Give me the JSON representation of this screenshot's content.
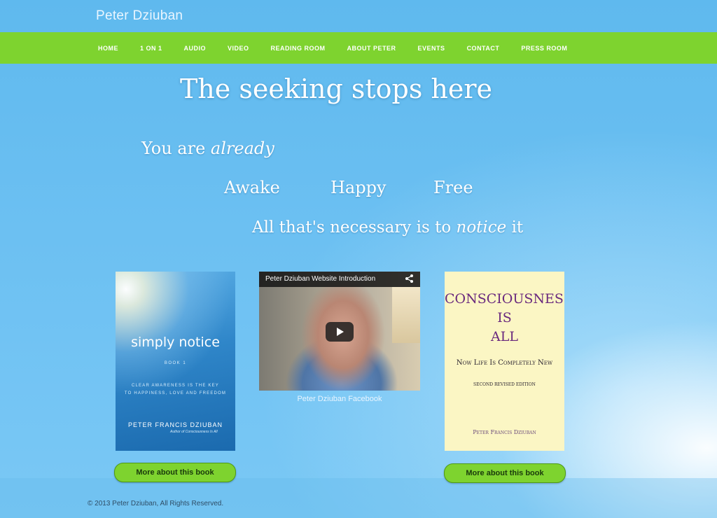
{
  "site": {
    "title": "Peter Dziuban"
  },
  "nav": {
    "items": [
      "HOME",
      "1 ON 1",
      "AUDIO",
      "VIDEO",
      "READING ROOM",
      "ABOUT PETER",
      "EVENTS",
      "CONTACT",
      "PRESS ROOM"
    ]
  },
  "hero": {
    "headline": "The seeking stops here",
    "line2_prefix": "You are ",
    "line2_em": "already",
    "words": [
      "Awake",
      "Happy",
      "Free"
    ],
    "line4_prefix": "All that's necessary is to ",
    "line4_em": "notice",
    "line4_suffix": " it"
  },
  "book1": {
    "title": "simply notice",
    "subtitle": "BOOK 1",
    "tagline_1": "CLEAR AWARENESS IS THE KEY",
    "tagline_2": "TO HAPPINESS, LOVE AND FREEDOM",
    "author": "PETER FRANCIS DZIUBAN",
    "byline": "Author of Consciousness Is All",
    "button": "More about this book"
  },
  "video": {
    "title": "Peter Dziuban Website Introduction",
    "caption": "Peter Dziuban Facebook"
  },
  "book2": {
    "title_1": "CONSCIOUSNESS",
    "title_2": "IS",
    "title_3": "ALL",
    "subtitle": "Now Life Is Completely New",
    "edition": "SECOND REVISED EDITION",
    "author": "Peter Francis Dziuban",
    "button": "More about this book"
  },
  "footer": {
    "copyright": "© 2013 Peter Dziuban, All Rights Reserved."
  },
  "colors": {
    "nav_green": "#7ed32f",
    "sky_blue": "#6cc0f2",
    "book_title_purple": "#6a2a7e"
  }
}
